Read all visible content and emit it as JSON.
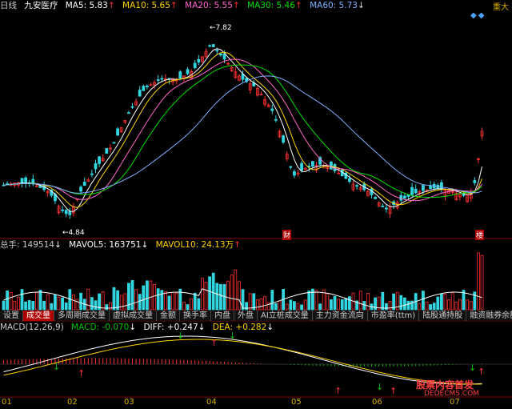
{
  "header": {
    "period": "日线",
    "stock_name": "九安医疗",
    "ma": [
      {
        "label": "MA5: 5.83",
        "arrow": "↑",
        "color": "#ffffff"
      },
      {
        "label": "MA10: 5.65",
        "arrow": "↑",
        "color": "#ffd200"
      },
      {
        "label": "MA20: 5.55",
        "arrow": "↑",
        "color": "#ff66cc"
      },
      {
        "label": "MA30: 5.46",
        "arrow": "↑",
        "color": "#00e000"
      },
      {
        "label": "MA60: 5.73",
        "arrow": "↓",
        "color": "#7fb0ff"
      }
    ],
    "right_cut": "重大"
  },
  "price": {
    "high_label": "7.82",
    "low_label": "4.84",
    "marker_cai": "财",
    "marker_lou": "楼"
  },
  "volume": {
    "label": "总手: 149514",
    "label_arrow": "↓",
    "mavol5": "MAVOL5: 163751",
    "mavol5_arrow": "↓",
    "mavol10": "MAVOL10: 24.13万",
    "mavol10_arrow": "↑"
  },
  "tabs": [
    "设置",
    "成交量",
    "多周期成交量",
    "虚拟成交量",
    "金额",
    "换手率",
    "内盘",
    "外盘",
    "AI立桩成交量",
    "主力资金流向",
    "市盈率(ttm)",
    "陆股通持股",
    "融资融券余额"
  ],
  "active_tab": "成交量",
  "macd": {
    "label": "MACD(12,26,9)",
    "macd": "MACD: -0.070",
    "macd_arrow": "↓",
    "diff": "DIFF: +0.247",
    "diff_arrow": "↓",
    "dea": "DEA: +0.282",
    "dea_arrow": "↓"
  },
  "months": [
    "01",
    "02",
    "03",
    "04",
    "05",
    "06",
    "07"
  ],
  "watermark": "股票内容首发",
  "watermark2": "DEDECMS.COM"
}
